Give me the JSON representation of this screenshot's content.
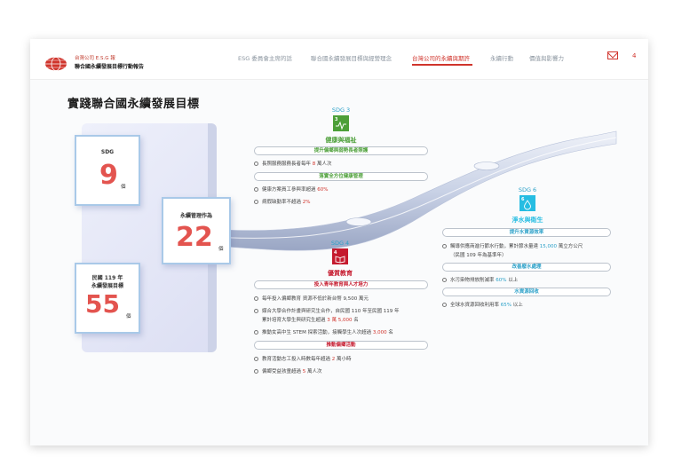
{
  "header": {
    "logo_line1": "台灣公司 E.S.G 報",
    "logo_line2": "聯合國永續發展目標行動報告",
    "nav": [
      "ESG 委員會主席的話",
      "聯合國永續發展目標與經營理念",
      "台灣公司的永續與期許",
      "永續行動",
      "價值與影響力"
    ],
    "active_nav": 2,
    "page_number": "4"
  },
  "title": "實踐聯合國永續發展目標",
  "cards": {
    "sdg": {
      "label": "SDG",
      "value": "9",
      "unit": "個"
    },
    "goals": {
      "label": "永續管理作為",
      "value": "22",
      "unit": "個"
    },
    "targets": {
      "label1": "民國 119 年",
      "label2": "永續發展目標",
      "value": "55",
      "unit": "個"
    }
  },
  "sdg3": {
    "tag": "SDG 3",
    "icon_num": "3",
    "title": "健康與福祉",
    "groups": [
      {
        "heading": "提升偏鄉與弱勢長者照護",
        "items": [
          {
            "pre": "長照服務服務長者每年 ",
            "val": "8",
            "post": " 萬人次"
          }
        ]
      },
      {
        "heading": "落實全方位健康管理",
        "items": [
          {
            "pre": "健康方案員工參與率超過 ",
            "val": "60%",
            "post": ""
          },
          {
            "pre": "病假缺勤率不超過 ",
            "val": "2%",
            "post": ""
          }
        ]
      }
    ]
  },
  "sdg4": {
    "tag": "SDG 4",
    "icon_num": "4",
    "title": "優質教育",
    "groups": [
      {
        "heading": "投入青年教育與人才培力",
        "items": [
          {
            "pre": "每年投入偏鄉教育 ",
            "val": "",
            "post": "資源不低於新台幣 9,500 萬元"
          },
          {
            "pre": "媒合大學合作計畫與研究生合作，自民國 110 年至民國 119 年",
            "val": "",
            "post": ""
          },
          {
            "pre": "累計培育大學生與研究生超過 ",
            "val": "3 萬 5,000",
            "post": " 名"
          },
          {
            "pre": "推動女高中生 STEM 探索活動，接觸學生人次超過 ",
            "val": "3,000",
            "post": " 名"
          }
        ]
      },
      {
        "heading": "推動偏鄉活動",
        "items": [
          {
            "pre": "教育活動志工投入時數每年超過 ",
            "val": "2",
            "post": " 萬小時"
          },
          {
            "pre": "偏鄉受益孩童超過 ",
            "val": "5",
            "post": " 萬人次"
          }
        ]
      }
    ]
  },
  "sdg6": {
    "tag": "SDG 6",
    "icon_num": "6",
    "title": "淨水與衛生",
    "groups": [
      {
        "heading": "提升水資源效率",
        "items": [
          {
            "pre": "觸導供應商進行節水行動，累計節水量達 ",
            "val": "15,000",
            "post": " 萬立方公尺"
          },
          {
            "pre": "（民國 109 年為基準年）",
            "val": "",
            "post": ""
          }
        ]
      },
      {
        "heading": "改善廢水處理",
        "items": [
          {
            "pre": "水污染物排放削減率 ",
            "val": "60%",
            "post": " 以上"
          }
        ]
      },
      {
        "heading": "水資源回收",
        "items": [
          {
            "pre": "全球水資源回收利用率 ",
            "val": "65%",
            "post": " 以上"
          }
        ]
      }
    ]
  },
  "colors": {
    "accent": "#d0342c",
    "sdg3": "#4c9f38",
    "sdg4": "#c5192d",
    "sdg6": "#26bde2",
    "card_num": "#e3544f",
    "tag": "#2aa0c8"
  }
}
